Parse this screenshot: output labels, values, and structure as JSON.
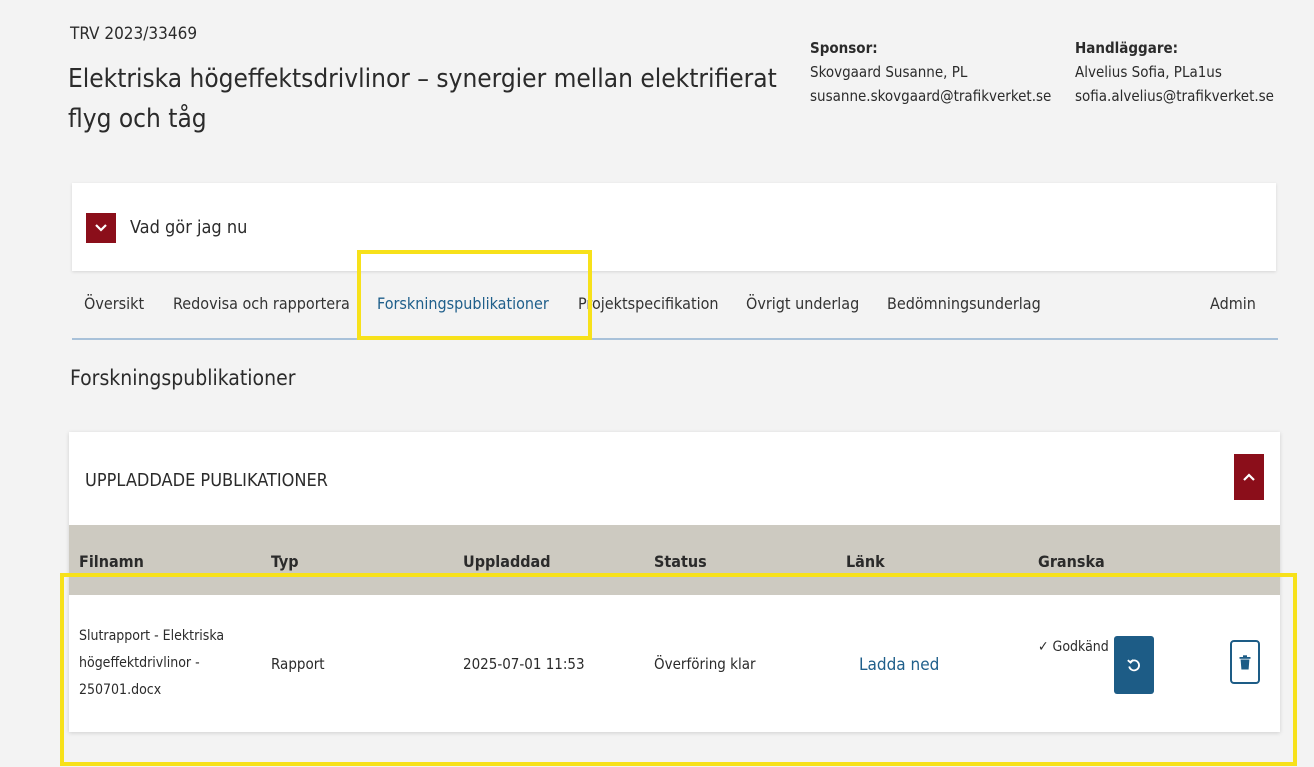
{
  "header": {
    "case_number": "TRV 2023/33469",
    "title": "Elektriska högeffektsdrivlinor – synergier mellan elektrifierat flyg och tåg",
    "sponsor": {
      "label": "Sponsor:",
      "name": "Skovgaard Susanne, PL",
      "email": "susanne.skovgaard@trafikverket.se"
    },
    "handler": {
      "label": "Handläggare:",
      "name": "Alvelius Sofia, PLa1us",
      "email": "sofia.alvelius@trafikverket.se"
    }
  },
  "what_now": {
    "label": "Vad gör jag nu"
  },
  "tabs": [
    {
      "label": "Översikt"
    },
    {
      "label": "Redovisa och rapportera"
    },
    {
      "label": "Forskningspublikationer"
    },
    {
      "label": "Projektspecifikation"
    },
    {
      "label": "Övrigt underlag"
    },
    {
      "label": "Bedömningsunderlag"
    },
    {
      "label": "Admin"
    }
  ],
  "section_title": "Forskningspublikationer",
  "publications": {
    "header": "UPPLADDADE PUBLIKATIONER",
    "columns": [
      "Filnamn",
      "Typ",
      "Uppladdad",
      "Status",
      "Länk",
      "Granska"
    ],
    "rows": [
      {
        "filename_lines": [
          "Slutrapport - Elektriska",
          "högeffektdrivlinor -",
          "250701.docx"
        ],
        "type": "Rapport",
        "uploaded": "2025-07-01 11:53",
        "status": "Överföring klar",
        "link": "Ladda ned",
        "review": "✓ Godkänd"
      }
    ]
  },
  "colors": {
    "accent_red": "#8b0e1a",
    "accent_blue": "#1d5c86",
    "highlight": "#f7e11a",
    "table_header": "#cdcac1"
  },
  "icons": [
    "chevron-down-icon",
    "chevron-up-icon",
    "reset-icon",
    "trash-icon"
  ]
}
